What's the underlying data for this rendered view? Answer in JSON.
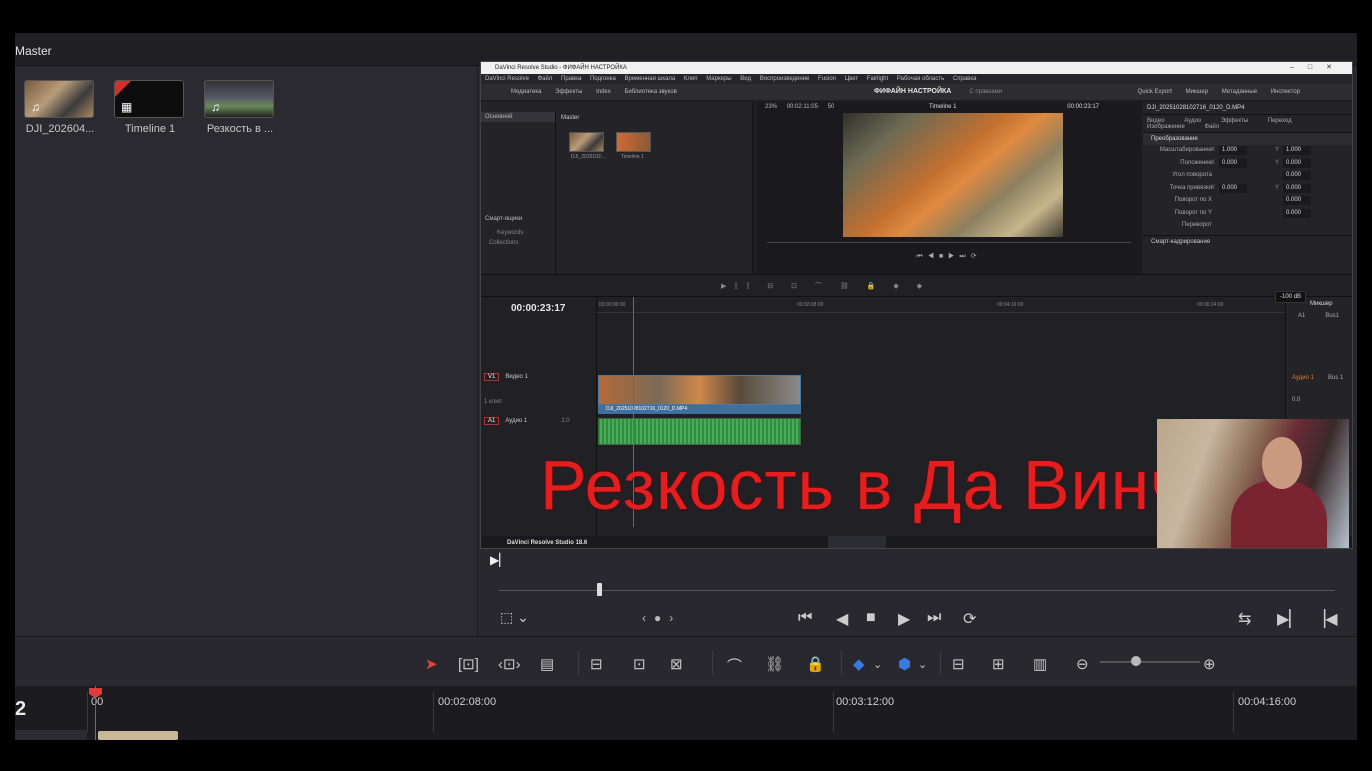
{
  "master_bin": {
    "label": "Master"
  },
  "clips": [
    {
      "name": "DJI_202604...",
      "glyph": "♫"
    },
    {
      "name": "Timeline 1",
      "glyph": "▦"
    },
    {
      "name": "Резкость в ...",
      "glyph": "♫"
    }
  ],
  "inner_window": {
    "title": "DaVinci Resolve Studio - ФИФАЙН НАСТРОЙКА",
    "menu": [
      "DaVinci Resolve",
      "Файл",
      "Правка",
      "Подгонка",
      "Временная шкала",
      "Клип",
      "Маркеры",
      "Вид",
      "Воспроизведение",
      "Fusion",
      "Цвет",
      "Fairlight",
      "Рабочая область",
      "Справка"
    ],
    "toolbar": [
      "Медиатека",
      "Эффекты",
      "Index",
      "Библиотека звуков"
    ],
    "project_name": "ФИФАЙН НАСТРОЙКА",
    "project_status": "С правками",
    "toolbar_right": [
      "Quick Export",
      "Микшер",
      "Метаданные",
      "Инспектор"
    ],
    "media": {
      "side_selected": "Основной",
      "smart_bins": "Смарт-ящики",
      "keywords": "Keywords",
      "collections": "Collections",
      "master": "Master",
      "thumbs": [
        {
          "name": "DJI_2025102..."
        },
        {
          "name": "Timeline 1"
        }
      ]
    },
    "viewer": {
      "zoom": "23%",
      "duration": "00:02:11:05",
      "fps": "50",
      "timeline_name": "Timeline 1",
      "timecode": "00:00:23:17"
    },
    "inspector": {
      "clip_name": "DJI_20251028102716_0120_D.MP4",
      "tabs": [
        "Видео",
        "Аудио",
        "Эффекты",
        "Переход",
        "Изображение",
        "Файл"
      ],
      "section": "Преобразование",
      "rows": [
        {
          "label": "Масштабирование",
          "x": "1.000",
          "y": "1.000"
        },
        {
          "label": "Положение",
          "x": "0.000",
          "y": "0.000"
        },
        {
          "label": "Угол поворота",
          "x": "",
          "y": "0.000"
        },
        {
          "label": "Точка привязки",
          "x": "0.000",
          "y": "0.000"
        },
        {
          "label": "Поворот по X",
          "x": "",
          "y": "0.000"
        },
        {
          "label": "Поворот по Y",
          "x": "",
          "y": "0.000"
        },
        {
          "label": "Переворот",
          "x": "",
          "y": ""
        }
      ],
      "smart_crop": "Смарт-кадрирование"
    },
    "timeline": {
      "timecode": "00:00:23:17",
      "ruler": [
        "00:00:00:00",
        "00:02:08:00",
        "00:04:16:00",
        "00:06:24:00"
      ],
      "video_track": {
        "tag": "V1",
        "name": "Видео 1",
        "sub": "1 клип"
      },
      "audio_track": {
        "tag": "A1",
        "name": "Аудио 1",
        "ch": "2.0"
      },
      "clip_name": "DJI_20251028102716_0120_D.MP4",
      "audio_clip_name": "DJI_20251028102716_0120_D.MP4"
    },
    "mixer": {
      "title": "Микшер",
      "a1": "A1",
      "bus1": "Bus1",
      "audio1": "Аудио 1",
      "bus1b": "Bus 1",
      "level": "0.0"
    },
    "tooltip": "-100 dB",
    "footer": "DaVinci Resolve Studio 18.6"
  },
  "overlay_title": "Резкость в Да Винчи",
  "main_timeline": {
    "track_number": "2",
    "ruler": [
      "00:02:08:00",
      "00:03:12:00",
      "00:04:16:00"
    ],
    "ruler_first": "00"
  },
  "colors": {
    "accent_red": "#e41e1e",
    "marker_blue": "#3a7ae0",
    "playhead": "#e03a3a"
  }
}
